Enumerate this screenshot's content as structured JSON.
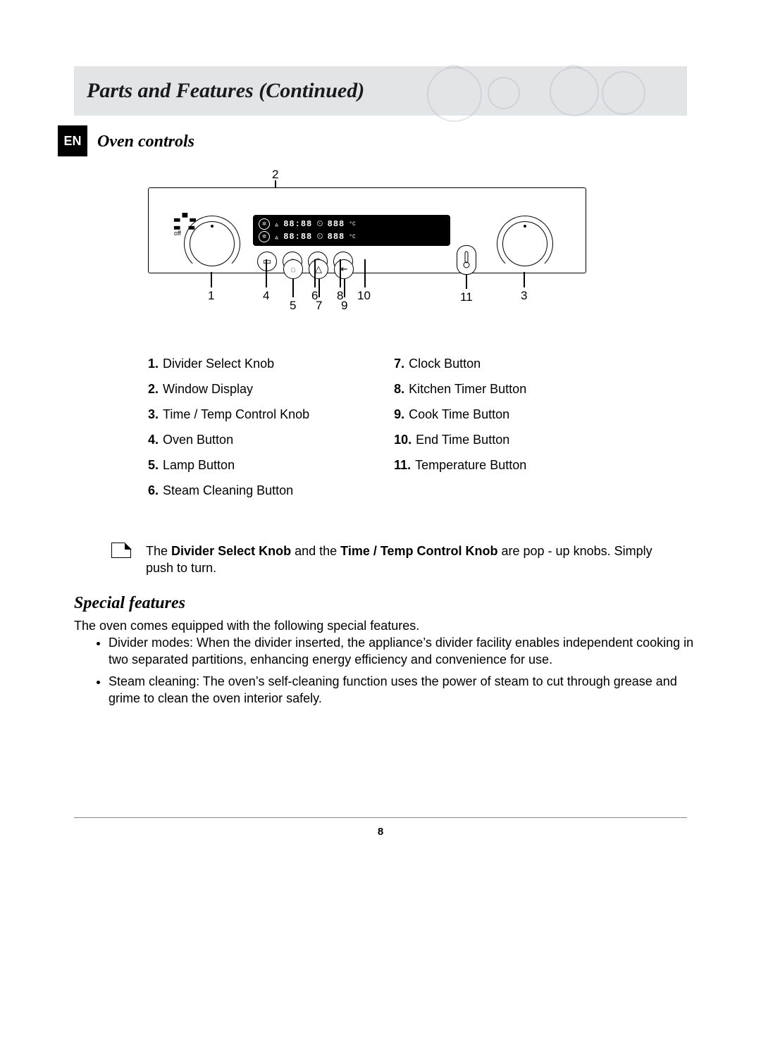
{
  "header": {
    "title": "Parts and Features (Continued)"
  },
  "lang_tag": "EN",
  "section": {
    "oven_controls": "Oven controls",
    "special_features": "Special features"
  },
  "diagram": {
    "off_label": "off",
    "callouts": [
      "1",
      "2",
      "3",
      "4",
      "5",
      "6",
      "7",
      "8",
      "9",
      "10",
      "11"
    ],
    "display_time": "88:88",
    "display_temp": "888"
  },
  "legend": {
    "col1": [
      {
        "n": "1.",
        "t": "Divider Select Knob"
      },
      {
        "n": "2.",
        "t": "Window Display"
      },
      {
        "n": "3.",
        "t": "Time / Temp Control Knob"
      },
      {
        "n": "4.",
        "t": "Oven Button"
      },
      {
        "n": "5.",
        "t": "Lamp Button"
      },
      {
        "n": "6.",
        "t": "Steam Cleaning Button"
      }
    ],
    "col2": [
      {
        "n": "7.",
        "t": "Clock Button"
      },
      {
        "n": "8.",
        "t": "Kitchen Timer Button"
      },
      {
        "n": "9.",
        "t": "Cook Time Button"
      },
      {
        "n": "10.",
        "t": "End Time Button"
      },
      {
        "n": "11.",
        "t": "Temperature Button"
      }
    ]
  },
  "note": {
    "prefix": "The ",
    "bold1": "Divider Select Knob",
    "mid": " and the ",
    "bold2": "Time / Temp Control Knob",
    "suffix": " are pop - up knobs. Simply push to turn."
  },
  "special": {
    "intro": "The oven comes equipped with the following special features.",
    "items": [
      "Divider modes: When the divider inserted, the appliance’s divider facility enables independent cooking in two separated partitions, enhancing energy efficiency and convenience for use.",
      "Steam cleaning: The oven’s self-cleaning function uses the power of steam to cut through grease and grime to clean the oven interior safely."
    ]
  },
  "page_number": "8"
}
